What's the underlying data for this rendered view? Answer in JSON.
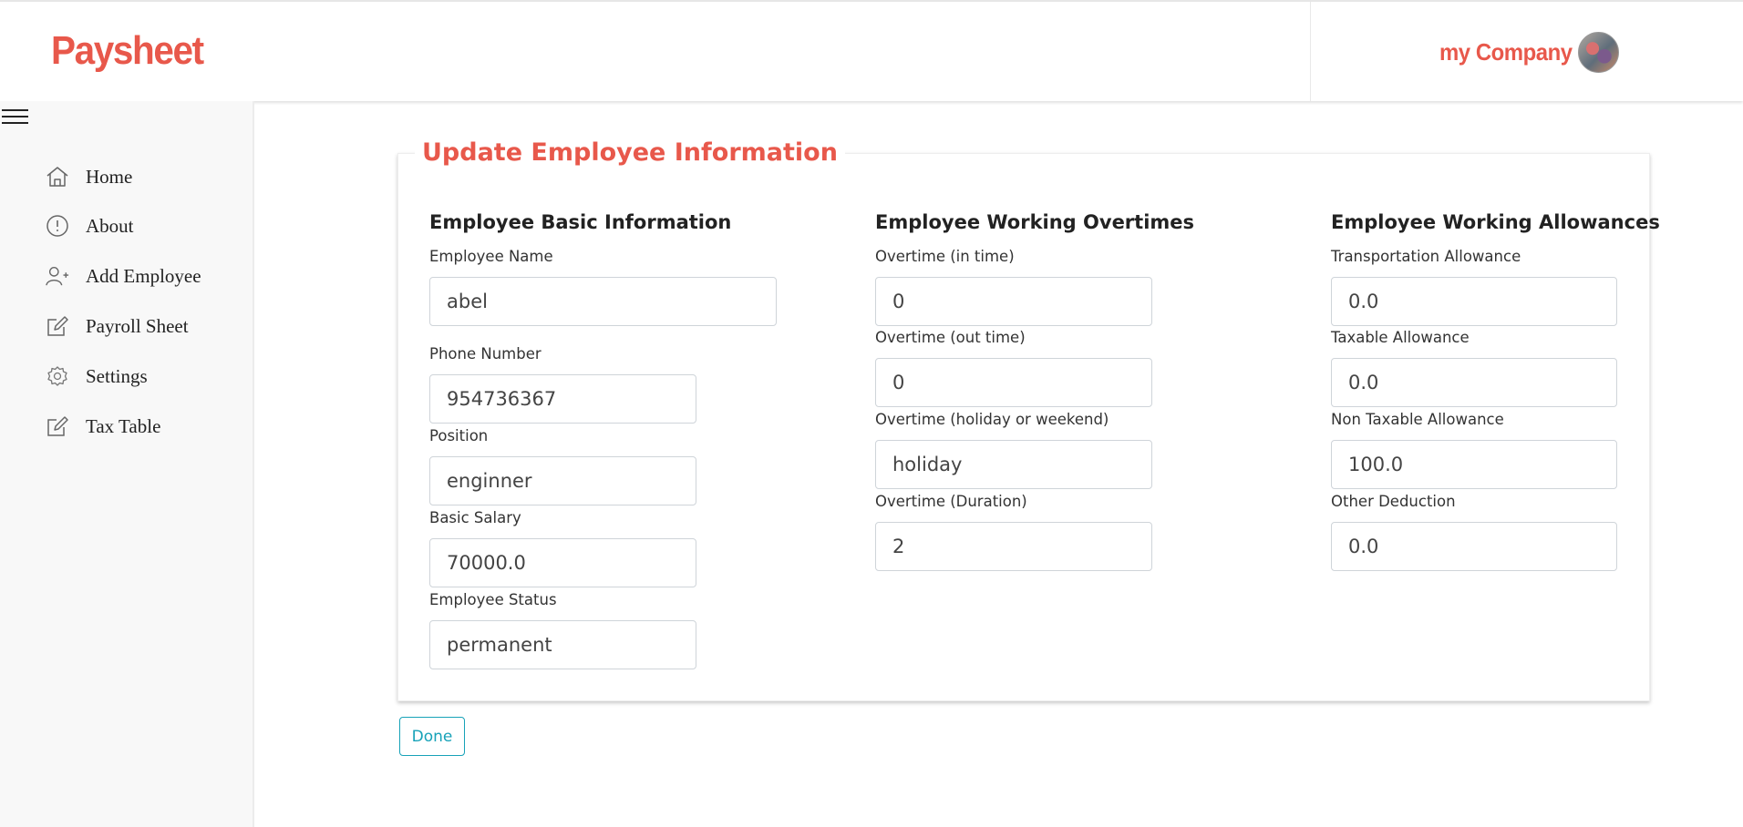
{
  "header": {
    "brand": "Paysheet",
    "company": "my Company"
  },
  "sidebar": {
    "items": [
      {
        "label": "Home",
        "icon": "home-icon"
      },
      {
        "label": "About",
        "icon": "info-icon"
      },
      {
        "label": "Add Employee",
        "icon": "add-user-icon"
      },
      {
        "label": "Payroll Sheet",
        "icon": "edit-icon"
      },
      {
        "label": "Settings",
        "icon": "gear-icon"
      },
      {
        "label": "Tax Table",
        "icon": "edit-icon"
      }
    ]
  },
  "form": {
    "title": "Update Employee Information",
    "basic": {
      "title": "Employee Basic Information",
      "fields": [
        {
          "label": "Employee Name",
          "value": "abel"
        },
        {
          "label": "Phone Number",
          "value": "954736367"
        },
        {
          "label": "Position",
          "value": "enginner"
        },
        {
          "label": "Basic Salary",
          "value": "70000.0"
        },
        {
          "label": "Employee Status",
          "value": "permanent"
        }
      ]
    },
    "overtimes": {
      "title": "Employee Working Overtimes",
      "fields": [
        {
          "label": "Overtime (in time)",
          "value": "0"
        },
        {
          "label": "Overtime (out time)",
          "value": "0"
        },
        {
          "label": "Overtime (holiday or weekend)",
          "value": "holiday"
        },
        {
          "label": "Overtime (Duration)",
          "value": "2"
        }
      ]
    },
    "allowances": {
      "title": "Employee Working Allowances",
      "fields": [
        {
          "label": "Transportation Allowance",
          "value": "0.0"
        },
        {
          "label": "Taxable Allowance",
          "value": "0.0"
        },
        {
          "label": "Non Taxable Allowance",
          "value": "100.0"
        },
        {
          "label": "Other Deduction",
          "value": "0.0"
        }
      ]
    },
    "done_label": "Done"
  },
  "colors": {
    "accent": "#e8584b",
    "button": "#17a2b8"
  }
}
